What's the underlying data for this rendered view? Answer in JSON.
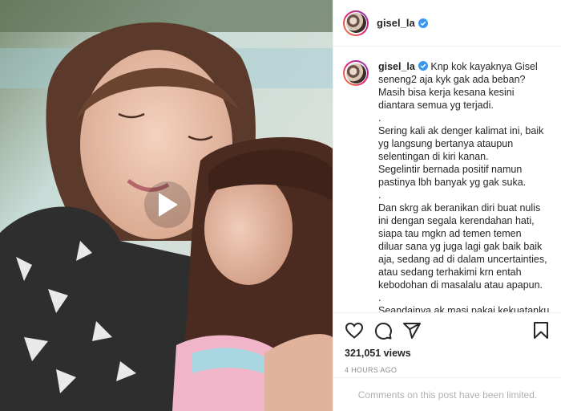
{
  "post": {
    "username": "gisel_la",
    "verified": true,
    "caption_lines": [
      "Knp kok kayaknya Gisel",
      "seneng2 aja kyk gak ada beban?",
      "Masih bisa kerja kesana kesini",
      "diantara semua yg terjadi.",
      ".",
      "Sering kali ak denger kalimat ini, baik",
      "yg langsung bertanya ataupun",
      "selentingan di kiri kanan.",
      "Segelintir bernada positif namun",
      "pastinya lbh banyak yg gak suka.",
      ".",
      "Dan skrg ak beranikan diri buat nulis",
      "ini dengan segala kerendahan hati,",
      "siapa tau mgkn ad temen temen",
      "diluar sana yg juga lagi gak baik baik",
      "aja, sedang ad di dalam uncertainties,",
      "atau sedang terhakimi krn entah",
      "kebodohan di masalalu atau apapun.",
      ".",
      "Seandainya ak masi pakai kekuatanku"
    ],
    "views": "321,051 views",
    "timestamp": "4 HOURS AGO",
    "comments_notice": "Comments on this post have been limited."
  },
  "icons": {
    "verified": "verified-badge-icon",
    "like": "heart-icon",
    "comment": "comment-icon",
    "share": "paper-plane-icon",
    "save": "bookmark-icon",
    "play": "play-icon"
  },
  "colors": {
    "verified": "#3897f0",
    "text": "#262626",
    "muted": "#8e8e8e",
    "border": "#efefef"
  }
}
